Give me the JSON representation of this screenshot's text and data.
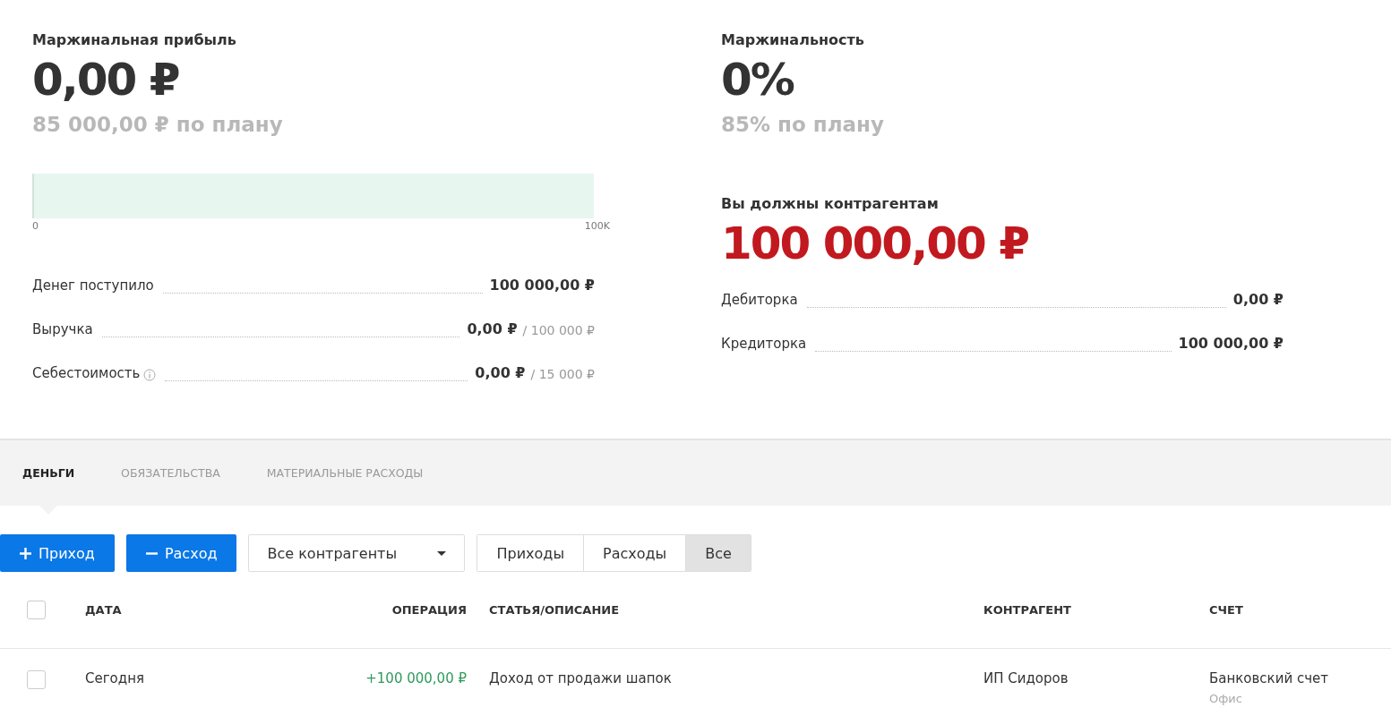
{
  "margin_profit": {
    "title": "Маржинальная прибыль",
    "value": "0,00 ₽",
    "plan": "85 000,00 ₽ по плану",
    "meter": {
      "level": 0,
      "min_label": "0",
      "max_label": "100K"
    },
    "lines": [
      {
        "label": "Денег поступило",
        "info": false,
        "value": "100 000,00 ₽"
      },
      {
        "label": "Выручка",
        "info": false,
        "value": "0,00 ₽",
        "plan": "/ 100 000 ₽"
      },
      {
        "label": "Себестоимость",
        "info": true,
        "value": "0,00 ₽",
        "plan": "/ 15 000 ₽"
      }
    ]
  },
  "marginality": {
    "title": "Маржинальность",
    "value": "0%",
    "plan": "85% по плану"
  },
  "debt": {
    "title": "Вы должны контрагентам",
    "value": "100 000,00 ₽",
    "lines": [
      {
        "label": "Дебиторка",
        "value": "0,00 ₽"
      },
      {
        "label": "Кредиторка",
        "value": "100 000,00 ₽"
      }
    ]
  },
  "tabs": [
    {
      "label": "ДЕНЬГИ",
      "selected": true
    },
    {
      "label": "ОБЯЗАТЕЛЬСТВА",
      "selected": false
    },
    {
      "label": "МАТЕРИАЛЬНЫЕ РАСХОДЫ",
      "selected": false
    }
  ],
  "toolbar": {
    "buttons": [
      {
        "kind": "plus",
        "label": "Приход"
      },
      {
        "kind": "minus",
        "label": "Расход"
      }
    ],
    "counterparty_select": "Все контрагенты",
    "filters": [
      {
        "label": "Приходы",
        "selected": false
      },
      {
        "label": "Расходы",
        "selected": false
      },
      {
        "label": "Все",
        "selected": true
      }
    ]
  },
  "table": {
    "select_all_checked": false,
    "columns": [
      "ДАТА",
      "ОПЕРАЦИЯ",
      "СТАТЬЯ/ОПИСАНИЕ",
      "КОНТРАГЕНТ",
      "СЧЕТ"
    ],
    "rows": [
      {
        "checked": false,
        "date": "Сегодня",
        "amount": "+100 000,00 ₽",
        "description": "Доход от продажи шапок",
        "counterparty": "ИП Сидоров",
        "account": "Банковский счет",
        "account_sub": "Офис"
      }
    ]
  }
}
